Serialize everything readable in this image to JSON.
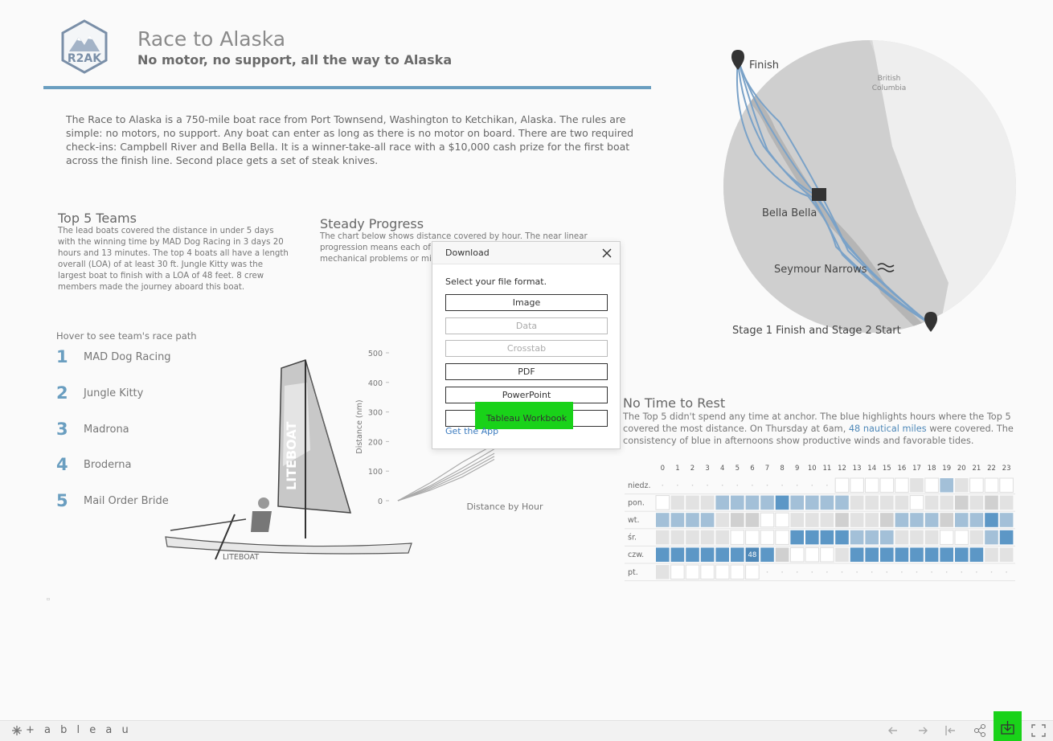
{
  "header": {
    "logo_text": "R2AK",
    "title": "Race to Alaska",
    "subtitle": "No motor, no support, all the way to Alaska"
  },
  "intro": "The Race to Alaska is a 750-mile boat race from Port Townsend, Washington to Ketchikan, Alaska. The rules are simple: no motors, no support. Any boat can enter as long as there is no motor on board. There are two required check-ins: Campbell River and Bella Bella. It is a winner-take-all race with a $10,000 cash prize for the first boat across the finish line. Second place gets a set of steak knives.",
  "top5": {
    "title": "Top 5 Teams",
    "description": "The lead boats covered the distance in under 5 days with the winning time by MAD Dog Racing in 3 days 20 hours and 13 minutes. The top 4 boats all have a length overall (LOA) of at least 30 ft. Jungle Kitty was the largest boat to finish with a LOA of 48 feet. 8 crew members made the journey aboard this boat.",
    "hover_hint": "Hover to see team's race path",
    "teams": [
      {
        "rank": "1",
        "name": "MAD Dog Racing"
      },
      {
        "rank": "2",
        "name": "Jungle Kitty"
      },
      {
        "rank": "3",
        "name": "Madrona"
      },
      {
        "rank": "4",
        "name": "Broderna"
      },
      {
        "rank": "5",
        "name": "Mail Order Bride"
      }
    ],
    "boat_label": "LITEBOAT",
    "sail_text": "LITEBOAT"
  },
  "steady": {
    "title": "Steady Progress",
    "description": "The chart below shows distance covered by hour. The near linear progression means each of these crews fo time of day, tides, passagewa mechanical problems or mish"
  },
  "chart_data": {
    "type": "line",
    "title": "Distance by Hour",
    "xlabel": "",
    "ylabel": "Distance (nm)",
    "ylim": [
      0,
      500
    ],
    "yticks": [
      0,
      100,
      200,
      300,
      400,
      500
    ],
    "grid": false,
    "series": [
      {
        "values": [
          0,
          60,
          130,
          190
        ]
      },
      {
        "values": [
          0,
          50,
          110,
          175
        ]
      },
      {
        "values": [
          0,
          45,
          100,
          160
        ]
      },
      {
        "values": [
          0,
          40,
          90,
          150
        ]
      },
      {
        "values": [
          0,
          35,
          80,
          140
        ]
      }
    ]
  },
  "map": {
    "labels": {
      "finish": "Finish",
      "british_columbia": "British\nColumbia",
      "bella_bella": "Bella Bella",
      "seymour": "Seymour Narrows",
      "stage1": "Stage 1 Finish and Stage 2 Start"
    }
  },
  "no_time": {
    "title": "No Time to Rest",
    "desc_before": "The Top 5 didn't spend any time at anchor. The blue highlights hours where the Top 5 covered the most distance. On Thursday at 6am, ",
    "desc_highlight": "48 nautical miles",
    "desc_after": " were covered. The consistency of blue in afternoons show productive winds and favorable tides.",
    "hours": [
      "0",
      "1",
      "2",
      "3",
      "4",
      "5",
      "6",
      "7",
      "8",
      "9",
      "10",
      "11",
      "12",
      "13",
      "14",
      "15",
      "16",
      "17",
      "18",
      "19",
      "20",
      "21",
      "22",
      "23"
    ],
    "days": [
      "niedz.",
      "pon.",
      "wt.",
      "śr.",
      "czw.",
      "pt."
    ],
    "cell_label": "48",
    "grid": [
      [
        -1,
        -1,
        -1,
        -1,
        -1,
        -1,
        -1,
        -1,
        -1,
        -1,
        -1,
        -1,
        0,
        0,
        0,
        0,
        0,
        1,
        0,
        3,
        1,
        0,
        0,
        0
      ],
      [
        0,
        1,
        1,
        1,
        3,
        3,
        3,
        3,
        4,
        3,
        3,
        3,
        3,
        1,
        1,
        1,
        1,
        0,
        1,
        1,
        2,
        1,
        2,
        1
      ],
      [
        3,
        3,
        3,
        3,
        1,
        2,
        2,
        0,
        0,
        1,
        1,
        1,
        2,
        1,
        1,
        2,
        3,
        3,
        3,
        2,
        3,
        3,
        4,
        3
      ],
      [
        1,
        1,
        1,
        1,
        1,
        0,
        0,
        0,
        0,
        4,
        4,
        4,
        4,
        3,
        3,
        3,
        1,
        1,
        1,
        0,
        0,
        1,
        3,
        4
      ],
      [
        4,
        4,
        4,
        4,
        4,
        4,
        5,
        4,
        2,
        0,
        0,
        0,
        1,
        4,
        4,
        4,
        4,
        4,
        4,
        4,
        4,
        4,
        1,
        1
      ],
      [
        1,
        0,
        0,
        0,
        0,
        0,
        0,
        -1,
        -1,
        -1,
        -1,
        -1,
        -1,
        -1,
        -1,
        -1,
        -1,
        -1,
        -1,
        -1,
        -1,
        -1,
        -1,
        -1
      ]
    ],
    "colors": [
      "#ffffff",
      "#e2e2e2",
      "#d0d0d0",
      "#a3c0d8",
      "#5c97c6",
      "#4e88b8"
    ]
  },
  "dialog": {
    "title": "Download",
    "prompt": "Select your file format.",
    "buttons": [
      {
        "label": "Image",
        "enabled": true
      },
      {
        "label": "Data",
        "enabled": false
      },
      {
        "label": "Crosstab",
        "enabled": false
      },
      {
        "label": "PDF",
        "enabled": true
      },
      {
        "label": "PowerPoint",
        "enabled": true
      },
      {
        "label": "Tableau Workbook",
        "enabled": true
      }
    ],
    "get_app": "Get the App"
  },
  "footer": {
    "brand": "+ a b l e a u"
  }
}
